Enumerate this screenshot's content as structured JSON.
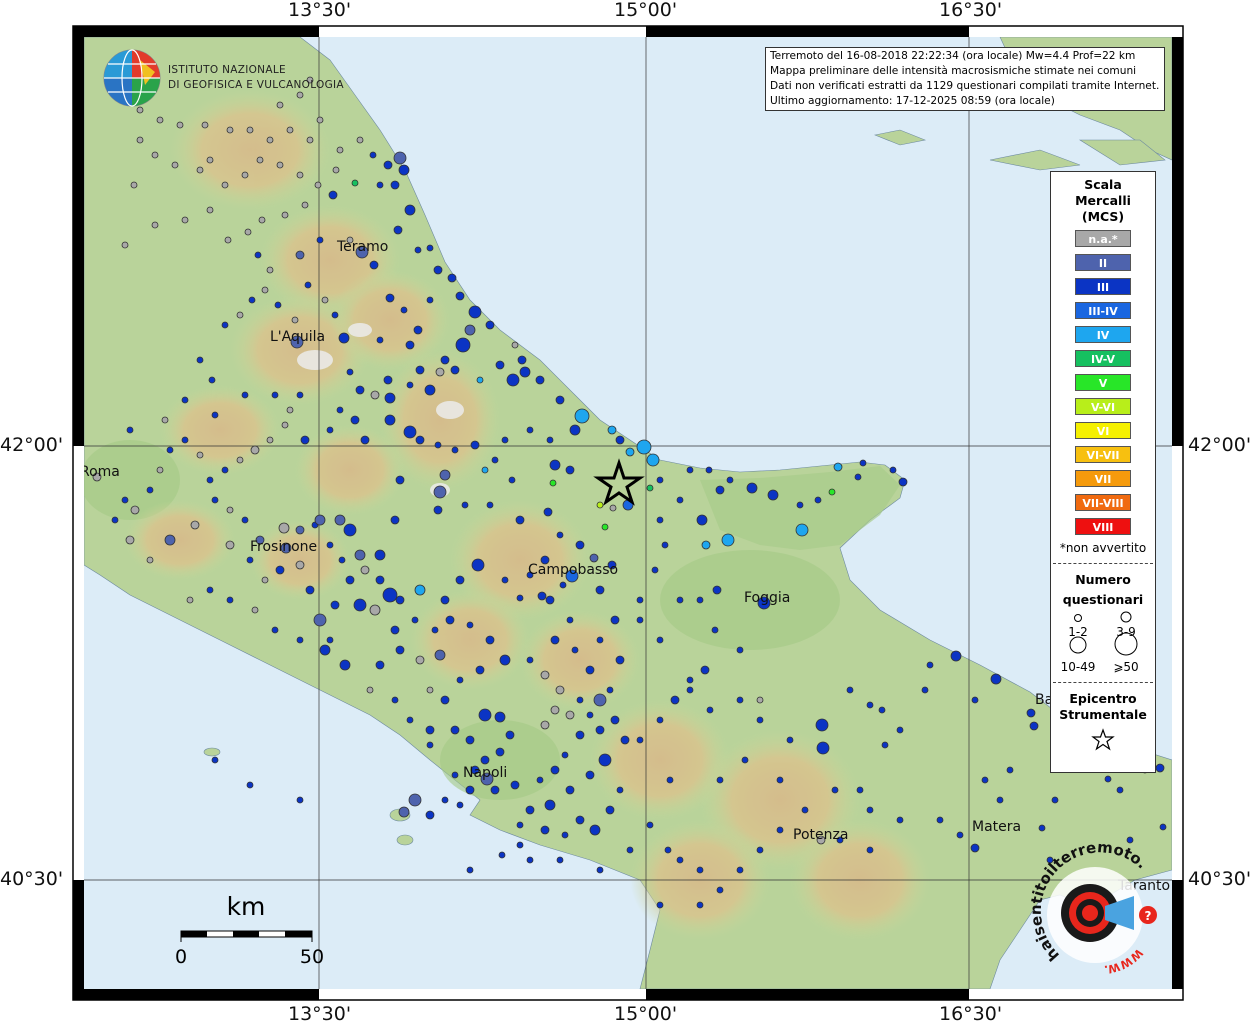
{
  "info": {
    "line1": "Terremoto del 16-08-2018 22:22:34 (ora locale) Mw=4.4 Prof=22 km",
    "line2": "Mappa preliminare delle intensità macrosismiche stimate nei comuni",
    "line3": "Dati non verificati estratti da 1129 questionari compilati tramite Internet.",
    "line4": "Ultimo aggiornamento: 17-12-2025 08:59 (ora locale)"
  },
  "logo": {
    "line1": "ISTITUTO NAZIONALE",
    "line2": "DI GEOFISICA E VULCANOLOGIA"
  },
  "axes": {
    "top": [
      "13°30'",
      "15°00'",
      "16°30'"
    ],
    "bottom": [
      "13°30'",
      "15°00'",
      "16°30'"
    ],
    "left": [
      "42°00'",
      "40°30'"
    ],
    "right": [
      "42°00'",
      "40°30'"
    ]
  },
  "cities": [
    "Teramo",
    "L'Aquila",
    "Roma",
    "Frosinone",
    "Campobasso",
    "Foggia",
    "Napoli",
    "Potenza",
    "Matera",
    "Taranto",
    "Ba"
  ],
  "legend": {
    "title1": "Scala",
    "title2": "Mercalli",
    "title3": "(MCS)",
    "levels": [
      {
        "label": "n.a.*",
        "color": "#a8a8a8"
      },
      {
        "label": "II",
        "color": "#4e63ad"
      },
      {
        "label": "III",
        "color": "#0b34c4"
      },
      {
        "label": "III-IV",
        "color": "#1a66e0"
      },
      {
        "label": "IV",
        "color": "#1ea6ef"
      },
      {
        "label": "IV-V",
        "color": "#16c060"
      },
      {
        "label": "V",
        "color": "#28e628"
      },
      {
        "label": "V-VI",
        "color": "#b8ee1a"
      },
      {
        "label": "VI",
        "color": "#f5f000"
      },
      {
        "label": "VI-VII",
        "color": "#f7c010"
      },
      {
        "label": "VII",
        "color": "#f59a0c"
      },
      {
        "label": "VII-VIII",
        "color": "#f06a10"
      },
      {
        "label": "VIII",
        "color": "#ee1010"
      }
    ],
    "na_note": "*non avvertito",
    "count_title1": "Numero",
    "count_title2": "questionari",
    "count_labels": [
      "1-2",
      "3-9",
      "10-49",
      "⩾50"
    ],
    "epi_title1": "Epicentro",
    "epi_title2": "Strumentale"
  },
  "scalebar": {
    "unit": "km",
    "min": "0",
    "max": "50"
  },
  "hsit": {
    "text": "haisentitoilterremoto.it",
    "url_text": "WWW.",
    "badge": "?"
  }
}
